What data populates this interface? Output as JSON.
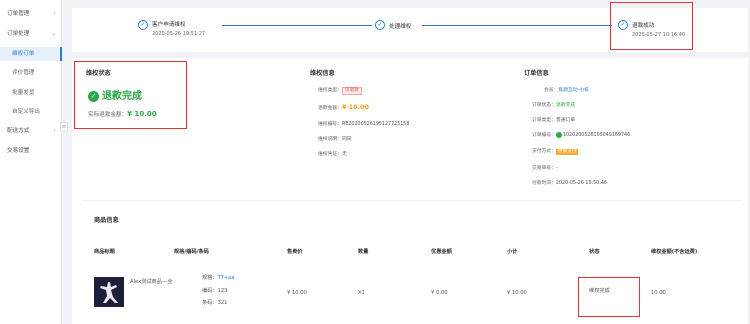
{
  "sidebar": {
    "items": [
      {
        "label": "订单管理",
        "chevron": "›"
      },
      {
        "label": "订单处理",
        "chevron": "⌄"
      },
      {
        "label": "维权订单"
      },
      {
        "label": "评价管理"
      },
      {
        "label": "批量发货"
      },
      {
        "label": "自定义导出"
      },
      {
        "label": "配送方式",
        "chevron": "›"
      },
      {
        "label": "交易设置"
      }
    ],
    "collapse_icon": "≡"
  },
  "steps": [
    {
      "title": "客户申请维权",
      "time": "2020-05-26 19:51:27"
    },
    {
      "title": "处理维权",
      "time": ""
    },
    {
      "title": "退款成功",
      "time": "2020-05-27 10:16:40"
    }
  ],
  "status": {
    "title": "维权状态",
    "big": "退款完成",
    "refund_label": "实际退款金额：",
    "refund_value": "¥ 10.00"
  },
  "rights": {
    "title": "维权信息",
    "type_label": "维权类型：",
    "type_value": "仅退款",
    "amount_label": "退款金额：",
    "amount_value": "¥ 10.00",
    "no_label": "维权编号：",
    "no_value": "RE20200526195127725158",
    "desc_label": "维权说明：",
    "desc_value": "同同",
    "proof_label": "维权凭证：",
    "proof_value": "无"
  },
  "order": {
    "title": "订单信息",
    "member_label": "会员：",
    "member_value": "焦颜互动-小栋",
    "status_label": "订单状态：",
    "status_value": "退款完成",
    "type_label": "订单类型：",
    "type_value": "普通订单",
    "no_label": "订单编号：",
    "no_value": "10202005261950491697​46",
    "pay_label": "支付方式：",
    "pay_value": "余额支付",
    "trade_label": "交易单号：",
    "trade_value": "-",
    "time_label": "付款时间：",
    "time_value": "2020-05-26 19:50:46"
  },
  "goods": {
    "title": "商品信息",
    "headers": [
      "商品标题",
      "规格/编码/条码",
      "售卖价",
      "数量",
      "优惠金额",
      "小计",
      "状态",
      "维权金额(不含运费)"
    ],
    "row": {
      "name": "Alex测试商品---全",
      "spec_label": "规格：",
      "spec_value": "TT+aa",
      "code_label": "编码：",
      "code_value": "123",
      "barcode_label": "条码：",
      "barcode_value": "321",
      "price": "¥ 10.00",
      "qty": "X1",
      "discount": "¥ 0.00",
      "subtotal": "¥ 10.00",
      "status": "维权完成",
      "refund": "10.00"
    }
  },
  "colors": {
    "accent": "#2b7ed8",
    "success": "#2aa846",
    "highlight": "#d9363e",
    "price": "#f39c12"
  }
}
